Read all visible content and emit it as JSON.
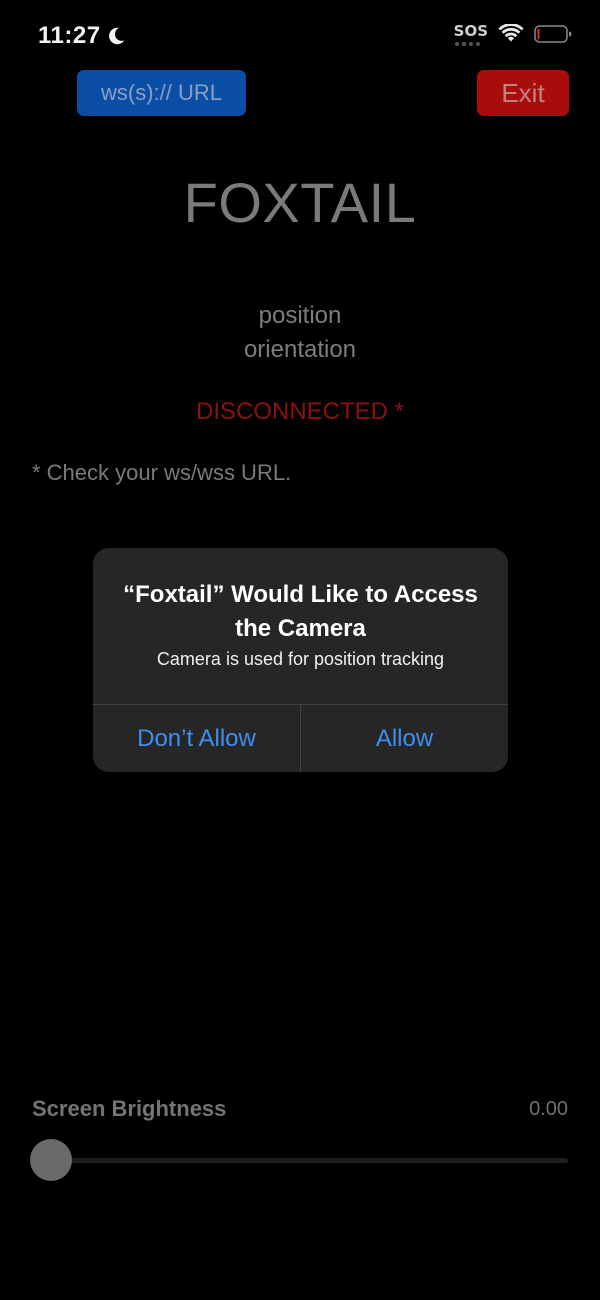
{
  "status_bar": {
    "time": "11:27",
    "focus_icon": "moon-icon",
    "sos": "SOS",
    "wifi_icon": "wifi-icon",
    "battery_icon": "battery-icon",
    "battery_level": 0.05,
    "battery_color": "#d32f2f"
  },
  "toolbar": {
    "url_label": "ws(s):// URL",
    "exit_label": "Exit"
  },
  "main": {
    "title": "FOXTAIL",
    "position_label": "position",
    "orientation_label": "orientation",
    "connection_status": "DISCONNECTED *",
    "url_hint": "* Check your ws/wss URL."
  },
  "alert": {
    "title": "“Foxtail” Would Like to Access the Camera",
    "message": "Camera is used for position tracking",
    "deny_label": "Don’t Allow",
    "allow_label": "Allow"
  },
  "brightness": {
    "label": "Screen Brightness",
    "value_text": "0.00",
    "value": 0.0
  },
  "colors": {
    "url_button": "#0a4ea6",
    "exit_button": "#a80c0c",
    "disconnected": "#8a1212",
    "alert_action": "#3d8ff0"
  }
}
